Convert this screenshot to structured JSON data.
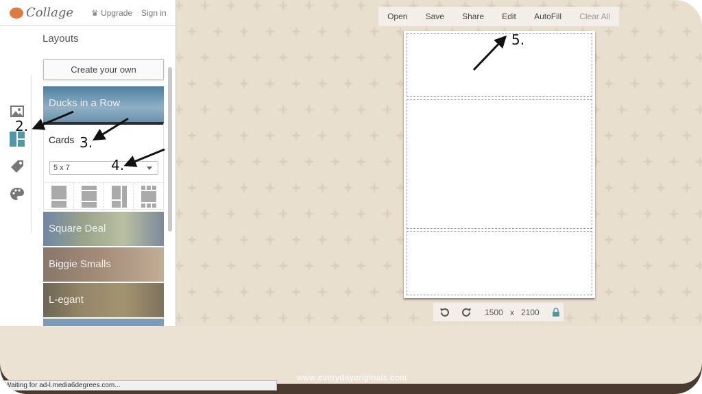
{
  "app": {
    "name": "Collage",
    "upgrade": "Upgrade",
    "signin": "Sign in"
  },
  "sidebar": {
    "heading": "Layouts",
    "create": "Create your own",
    "layouts": [
      {
        "label": "Ducks in a Row"
      },
      {
        "label": "Square Deal"
      },
      {
        "label": "Biggie Smalls"
      },
      {
        "label": "L-egant"
      }
    ],
    "cards": {
      "label": "Cards",
      "size": "5 x 7"
    },
    "rail": [
      "photos-icon",
      "layouts-icon",
      "stickers-icon",
      "palette-icon"
    ]
  },
  "toolbar": {
    "open": "Open",
    "save": "Save",
    "share": "Share",
    "edit": "Edit",
    "autofill": "AutoFill",
    "clear": "Clear All"
  },
  "canvas": {
    "width": "1500",
    "times": "x",
    "height": "2100"
  },
  "footer": "www.everydayoriginals.com",
  "status": "Waiting for ad-l.media6degrees.com...",
  "annotations": [
    "2.",
    "3.",
    "4.",
    "5."
  ],
  "colors": {
    "accent": "#4f98a8",
    "logo": "#e27a3f",
    "background": "#e9dfce"
  }
}
